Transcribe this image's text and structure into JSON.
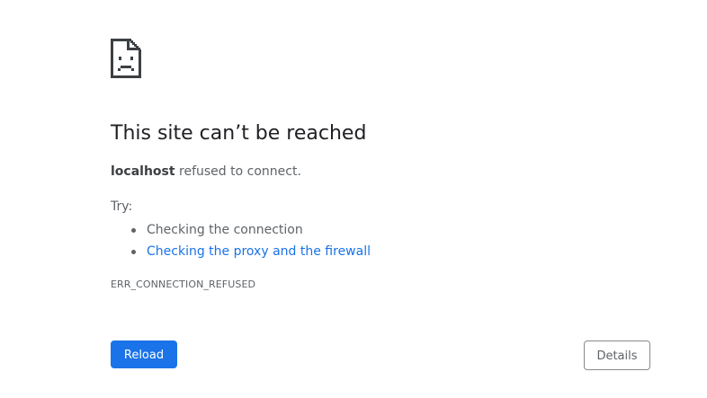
{
  "error_page": {
    "icon": "sad-page-icon",
    "title": "This site can’t be reached",
    "host": "localhost",
    "summary_suffix": " refused to connect.",
    "try_label": "Try:",
    "suggestions": [
      {
        "text": "Checking the connection",
        "link": false
      },
      {
        "text": "Checking the proxy and the firewall",
        "link": true
      }
    ],
    "error_code": "ERR_CONNECTION_REFUSED",
    "reload_label": "Reload",
    "details_label": "Details"
  },
  "colors": {
    "accent": "#1a73e8",
    "text_primary": "#202124",
    "text_secondary": "#5f6368"
  }
}
